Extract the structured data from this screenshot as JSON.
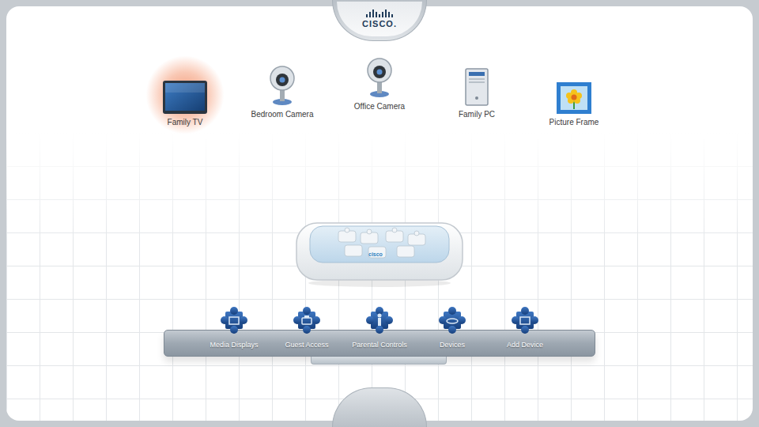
{
  "logo": {
    "text": "CISCO."
  },
  "devices": [
    {
      "label": "Family TV",
      "kind": "tv",
      "selected": true
    },
    {
      "label": "Bedroom Camera",
      "kind": "camera",
      "selected": false
    },
    {
      "label": "Office Camera",
      "kind": "camera",
      "selected": false
    },
    {
      "label": "Family PC",
      "kind": "pc",
      "selected": false
    },
    {
      "label": "Picture Frame",
      "kind": "frame",
      "selected": false
    }
  ],
  "router": {
    "label": "cisco"
  },
  "toolbar": [
    {
      "label": "Media Displays"
    },
    {
      "label": "Guest Access"
    },
    {
      "label": "Parental Controls"
    },
    {
      "label": "Devices"
    },
    {
      "label": "Add Device"
    }
  ]
}
